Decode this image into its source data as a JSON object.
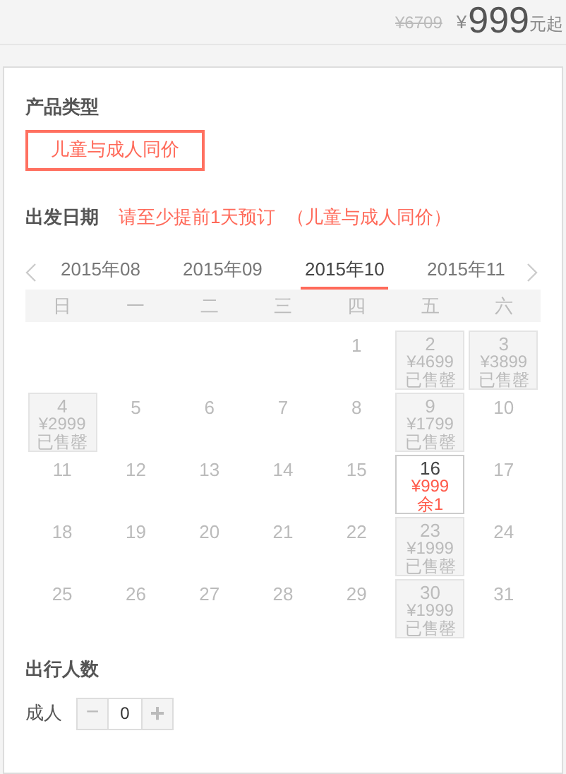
{
  "price_bar": {
    "original_price": "¥6709",
    "currency": "¥",
    "price": "999",
    "suffix": "元起"
  },
  "product_type": {
    "title": "产品类型",
    "options": [
      {
        "label": "儿童与成人同价",
        "selected": true
      }
    ]
  },
  "departure": {
    "title": "出发日期",
    "notice": "请至少提前1天预订",
    "note": "（儿童与成人同价）"
  },
  "months": [
    {
      "label": "2015年08",
      "selected": false
    },
    {
      "label": "2015年09",
      "selected": false
    },
    {
      "label": "2015年10",
      "selected": true
    },
    {
      "label": "2015年11",
      "selected": false
    }
  ],
  "weekdays": [
    "日",
    "一",
    "二",
    "三",
    "四",
    "五",
    "六"
  ],
  "weeks": [
    [
      {
        "kind": "empty"
      },
      {
        "kind": "empty"
      },
      {
        "kind": "empty"
      },
      {
        "kind": "empty"
      },
      {
        "kind": "plain",
        "day": "1"
      },
      {
        "kind": "soldout",
        "day": "2",
        "price": "¥4699",
        "status": "已售罄"
      },
      {
        "kind": "soldout",
        "day": "3",
        "price": "¥3899",
        "status": "已售罄"
      }
    ],
    [
      {
        "kind": "soldout",
        "day": "4",
        "price": "¥2999",
        "status": "已售罄"
      },
      {
        "kind": "plain",
        "day": "5"
      },
      {
        "kind": "plain",
        "day": "6"
      },
      {
        "kind": "plain",
        "day": "7"
      },
      {
        "kind": "plain",
        "day": "8"
      },
      {
        "kind": "soldout",
        "day": "9",
        "price": "¥1799",
        "status": "已售罄"
      },
      {
        "kind": "plain",
        "day": "10"
      }
    ],
    [
      {
        "kind": "plain",
        "day": "11"
      },
      {
        "kind": "plain",
        "day": "12"
      },
      {
        "kind": "plain",
        "day": "13"
      },
      {
        "kind": "plain",
        "day": "14"
      },
      {
        "kind": "plain",
        "day": "15"
      },
      {
        "kind": "available",
        "day": "16",
        "price": "¥999",
        "status": "余1"
      },
      {
        "kind": "plain",
        "day": "17"
      }
    ],
    [
      {
        "kind": "plain",
        "day": "18"
      },
      {
        "kind": "plain",
        "day": "19"
      },
      {
        "kind": "plain",
        "day": "20"
      },
      {
        "kind": "plain",
        "day": "21"
      },
      {
        "kind": "plain",
        "day": "22"
      },
      {
        "kind": "soldout",
        "day": "23",
        "price": "¥1999",
        "status": "已售罄"
      },
      {
        "kind": "plain",
        "day": "24"
      }
    ],
    [
      {
        "kind": "plain",
        "day": "25"
      },
      {
        "kind": "plain",
        "day": "26"
      },
      {
        "kind": "plain",
        "day": "27"
      },
      {
        "kind": "plain",
        "day": "28"
      },
      {
        "kind": "plain",
        "day": "29"
      },
      {
        "kind": "soldout",
        "day": "30",
        "price": "¥1999",
        "status": "已售罄"
      },
      {
        "kind": "plain",
        "day": "31"
      }
    ]
  ],
  "travelers": {
    "title": "出行人数",
    "label": "成人",
    "decrement": "−",
    "value": "0",
    "increment": "+"
  }
}
